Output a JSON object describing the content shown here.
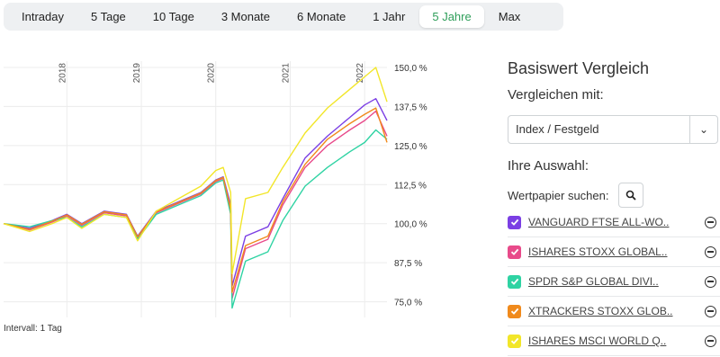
{
  "tabs": [
    {
      "label": "Intraday",
      "active": false
    },
    {
      "label": "5 Tage",
      "active": false
    },
    {
      "label": "10 Tage",
      "active": false
    },
    {
      "label": "3 Monate",
      "active": false
    },
    {
      "label": "6 Monate",
      "active": false
    },
    {
      "label": "1 Jahr",
      "active": false
    },
    {
      "label": "5 Jahre",
      "active": true
    },
    {
      "label": "Max",
      "active": false
    }
  ],
  "chart_data": {
    "type": "line",
    "x_ticks": [
      "2018",
      "2019",
      "2020",
      "2021",
      "2022"
    ],
    "y_ticks": [
      "150,0 %",
      "137,5 %",
      "125,0 %",
      "112,5 %",
      "100,0 %",
      "87,5 %",
      "75,0 %"
    ],
    "y_tick_values": [
      150,
      137.5,
      125,
      112.5,
      100,
      87.5,
      75
    ],
    "x": [
      2017.15,
      2017.5,
      2017.8,
      2018.0,
      2018.2,
      2018.5,
      2018.8,
      2018.95,
      2019.2,
      2019.5,
      2019.8,
      2020.0,
      2020.1,
      2020.2,
      2020.22,
      2020.4,
      2020.7,
      2020.9,
      2021.2,
      2021.5,
      2021.8,
      2022.0,
      2022.15,
      2022.3
    ],
    "series": [
      {
        "name": "VANGUARD FTSE ALL-WO..",
        "color": "#7b3fe4",
        "values": [
          100,
          98.5,
          101,
          103,
          100,
          104,
          103,
          96,
          104,
          107,
          110,
          114,
          115,
          106,
          80,
          96,
          99,
          108,
          121,
          128,
          134,
          138,
          140,
          133
        ]
      },
      {
        "name": "ISHARES STOXX GLOBAL..",
        "color": "#e84a8a",
        "values": [
          100,
          98,
          100.5,
          102.5,
          99.5,
          103.5,
          102.5,
          95.5,
          103.5,
          106.5,
          109.5,
          113.5,
          114.5,
          105,
          76,
          92,
          95,
          106,
          118,
          125,
          130,
          133,
          136,
          128
        ]
      },
      {
        "name": "SPDR S&P GLOBAL DIVI..",
        "color": "#2fd3a3",
        "values": [
          100,
          99,
          101,
          102,
          99,
          103,
          102,
          95,
          103,
          106,
          109,
          113,
          114,
          103,
          73,
          88,
          91,
          101,
          112,
          118,
          123,
          126,
          130,
          127
        ]
      },
      {
        "name": "XTRACKERS STOXX GLOB..",
        "color": "#f08a1c",
        "values": [
          100,
          98.2,
          100.8,
          102.8,
          99.8,
          103.8,
          102.8,
          95.8,
          103.8,
          106.8,
          109.8,
          113.8,
          114.8,
          104.5,
          78,
          93,
          96,
          107,
          119,
          127,
          132,
          135,
          137,
          126
        ]
      },
      {
        "name": "ISHARES MSCI WORLD Q..",
        "color": "#f2e629",
        "values": [
          100,
          97.5,
          100,
          102,
          98.5,
          103,
          102,
          94.5,
          104,
          108,
          112,
          117,
          118,
          110,
          84,
          108,
          110,
          118,
          129,
          137,
          143,
          147,
          150,
          139
        ]
      }
    ],
    "ylim": [
      70,
      152
    ],
    "xlim": [
      2017.15,
      2022.3
    ],
    "grid": true
  },
  "interval_label": "Intervall: 1 Tag",
  "panel": {
    "title": "Basiswert Vergleich",
    "compare_label": "Vergleichen mit:",
    "select_value": "Index / Festgeld",
    "selection_label": "Ihre Auswahl:",
    "search_label": "Wertpapier suchen:"
  },
  "selected_items": [
    {
      "label": "VANGUARD FTSE ALL-WO..",
      "color": "#7b3fe4"
    },
    {
      "label": "ISHARES STOXX GLOBAL..",
      "color": "#e84a8a"
    },
    {
      "label": "SPDR S&P GLOBAL DIVI..",
      "color": "#2fd3a3"
    },
    {
      "label": "XTRACKERS STOXX GLOB..",
      "color": "#f08a1c"
    },
    {
      "label": "ISHARES MSCI WORLD Q..",
      "color": "#f2e629"
    }
  ]
}
